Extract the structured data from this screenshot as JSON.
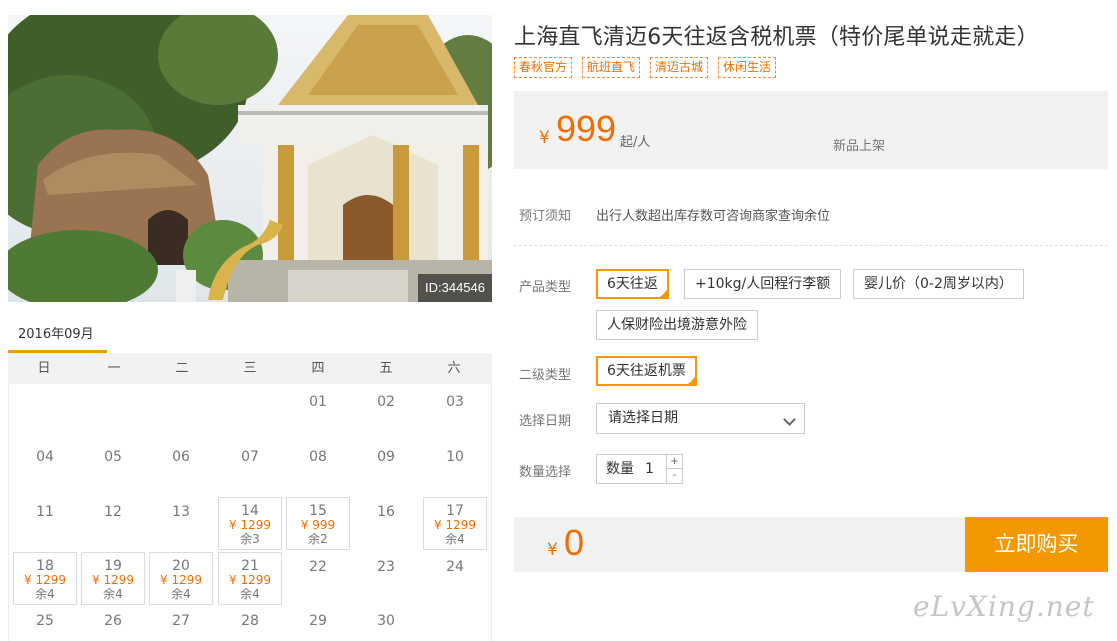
{
  "photo": {
    "id_label": "ID:344546"
  },
  "calendar": {
    "month": "2016年09月",
    "weekdays": [
      "日",
      "一",
      "二",
      "三",
      "四",
      "五",
      "六"
    ],
    "rows": [
      [
        null,
        null,
        null,
        null,
        {
          "d": "01"
        },
        {
          "d": "02"
        },
        {
          "d": "03"
        }
      ],
      [
        {
          "d": "04"
        },
        {
          "d": "05"
        },
        {
          "d": "06"
        },
        {
          "d": "07"
        },
        {
          "d": "08"
        },
        {
          "d": "09"
        },
        {
          "d": "10"
        }
      ],
      [
        {
          "d": "11"
        },
        {
          "d": "12"
        },
        {
          "d": "13"
        },
        {
          "d": "14",
          "price": "¥ 1299",
          "rest": "余3"
        },
        {
          "d": "15",
          "price": "¥ 999",
          "rest": "余2"
        },
        {
          "d": "16"
        },
        {
          "d": "17",
          "price": "¥ 1299",
          "rest": "余4"
        }
      ],
      [
        {
          "d": "18",
          "price": "¥ 1299",
          "rest": "余4"
        },
        {
          "d": "19",
          "price": "¥ 1299",
          "rest": "余4"
        },
        {
          "d": "20",
          "price": "¥ 1299",
          "rest": "余4"
        },
        {
          "d": "21",
          "price": "¥ 1299",
          "rest": "余4"
        },
        {
          "d": "22"
        },
        {
          "d": "23"
        },
        {
          "d": "24"
        }
      ],
      [
        {
          "d": "25"
        },
        {
          "d": "26"
        },
        {
          "d": "27"
        },
        {
          "d": "28"
        },
        {
          "d": "29"
        },
        {
          "d": "30"
        },
        null
      ]
    ]
  },
  "product": {
    "title": "上海直飞清迈6天往返含税机票（特价尾单说走就走）",
    "tags": [
      "春秋官方",
      "航班直飞",
      "清迈古城",
      "休闲生活"
    ]
  },
  "price": {
    "currency": "¥",
    "amount": "999",
    "unit": "起/人",
    "status": "新品上架"
  },
  "notice": {
    "label": "预订须知",
    "text": "出行人数超出库存数可咨询商家查询余位"
  },
  "product_type": {
    "label": "产品类型",
    "options": [
      "6天往返",
      "+10kg/人回程行李额",
      "婴儿价（0-2周岁以内）",
      "人保财险出境游意外险"
    ],
    "selected": "6天往返"
  },
  "sub_type": {
    "label": "二级类型",
    "options": [
      "6天往返机票"
    ],
    "selected": "6天往返机票"
  },
  "date": {
    "label": "选择日期",
    "placeholder": "请选择日期"
  },
  "quantity": {
    "label": "数量选择",
    "field_label": "数量",
    "value": "1",
    "plus": "+",
    "minus": "-"
  },
  "total": {
    "currency": "¥",
    "amount": "0"
  },
  "buy_button": {
    "label": "立即购买"
  },
  "watermark": "eLvXing.net",
  "colors": {
    "accent": "#f39800",
    "price": "#f06d00",
    "panel_bg": "#f2f2f2"
  }
}
